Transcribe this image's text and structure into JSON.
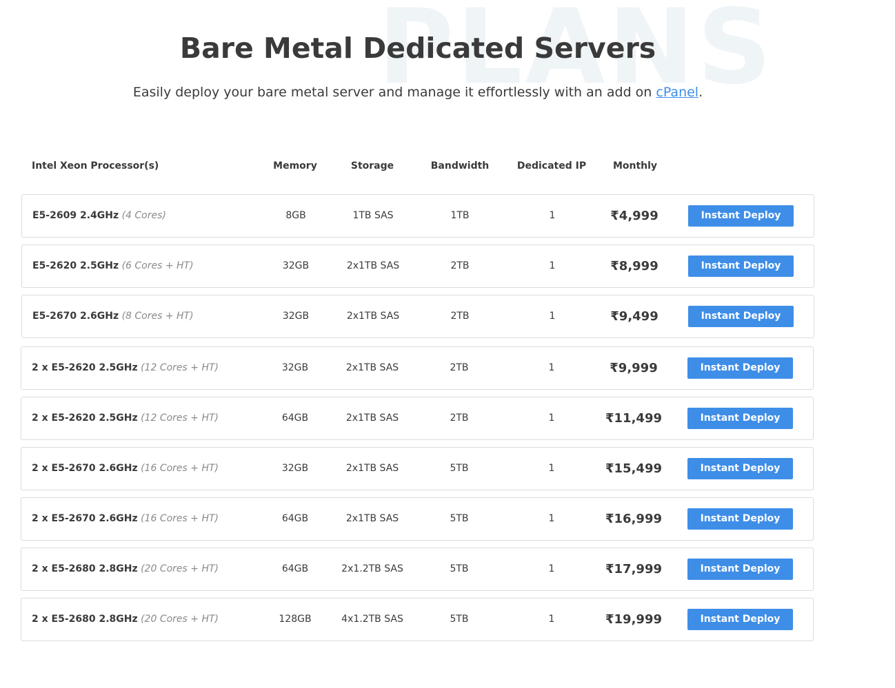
{
  "hero": {
    "watermark": "PLANS",
    "title": "Bare Metal Dedicated Servers",
    "subtitle_prefix": "Easily deploy your bare metal server and manage it effortlessly with an add on ",
    "subtitle_link": "cPanel",
    "subtitle_suffix": "."
  },
  "table": {
    "headers": {
      "processor": "Intel Xeon Processor(s)",
      "memory": "Memory",
      "storage": "Storage",
      "bandwidth": "Bandwidth",
      "dedicated_ip": "Dedicated IP",
      "monthly": "Monthly"
    },
    "currency_symbol": "₹",
    "deploy_label": "Instant Deploy",
    "rows": [
      {
        "processor": "E5-2609 2.4GHz",
        "cores": "(4 Cores)",
        "memory": "8GB",
        "storage": "1TB SAS",
        "bandwidth": "1TB",
        "ip": "1",
        "price": "4,999"
      },
      {
        "processor": "E5-2620 2.5GHz",
        "cores": "(6 Cores + HT)",
        "memory": "32GB",
        "storage": "2x1TB SAS",
        "bandwidth": "2TB",
        "ip": "1",
        "price": "8,999"
      },
      {
        "processor": "E5-2670 2.6GHz",
        "cores": "(8 Cores + HT)",
        "memory": "32GB",
        "storage": "2x1TB SAS",
        "bandwidth": "2TB",
        "ip": "1",
        "price": "9,499"
      },
      {
        "processor": "2 x E5-2620 2.5GHz",
        "cores": "(12 Cores + HT)",
        "memory": "32GB",
        "storage": "2x1TB SAS",
        "bandwidth": "2TB",
        "ip": "1",
        "price": "9,999"
      },
      {
        "processor": "2 x E5-2620 2.5GHz",
        "cores": "(12 Cores + HT)",
        "memory": "64GB",
        "storage": "2x1TB SAS",
        "bandwidth": "2TB",
        "ip": "1",
        "price": "11,499"
      },
      {
        "processor": "2 x E5-2670 2.6GHz",
        "cores": "(16 Cores + HT)",
        "memory": "32GB",
        "storage": "2x1TB SAS",
        "bandwidth": "5TB",
        "ip": "1",
        "price": "15,499"
      },
      {
        "processor": "2 x E5-2670 2.6GHz",
        "cores": "(16 Cores + HT)",
        "memory": "64GB",
        "storage": "2x1TB SAS",
        "bandwidth": "5TB",
        "ip": "1",
        "price": "16,999"
      },
      {
        "processor": "2 x E5-2680 2.8GHz",
        "cores": "(20 Cores + HT)",
        "memory": "64GB",
        "storage": "2x1.2TB SAS",
        "bandwidth": "5TB",
        "ip": "1",
        "price": "17,999"
      },
      {
        "processor": "2 x E5-2680 2.8GHz",
        "cores": "(20 Cores + HT)",
        "memory": "128GB",
        "storage": "4x1.2TB SAS",
        "bandwidth": "5TB",
        "ip": "1",
        "price": "19,999"
      }
    ]
  }
}
